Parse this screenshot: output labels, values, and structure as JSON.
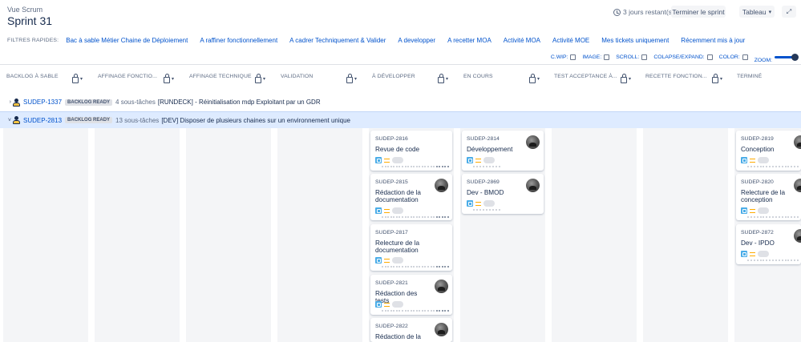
{
  "header": {
    "breadcrumb": "Vue Scrum",
    "title": "Sprint 31",
    "days_remaining": "3 jours restant(s)",
    "end_sprint_label": "Terminer le sprint",
    "board_label": "Tableau",
    "expand_icon": "expand-icon"
  },
  "filters": {
    "label": "FILTRES RAPIDES:",
    "items": [
      "Bac à sable Métier Chaine de Déploiement",
      "A raffiner fonctionnellement",
      "A cadrer Techniquement & Valider",
      "A developper",
      "A recetter MOA",
      "Activité MOA",
      "Activité MOE",
      "Mes tickets uniquement",
      "Récemment mis à jour"
    ]
  },
  "toggles": {
    "cwip": "C.WIP:",
    "image": "IMAGE:",
    "scroll": "SCROLL:",
    "colapse": "COLAPSE/EXPAND:",
    "color": "COLOR:",
    "zoom": "ZOOM:"
  },
  "columns": [
    "BACKLOG À SABLE",
    "AFFINAGE FONCTIO...",
    "AFFINAGE TECHNIQUE",
    "VALIDATION",
    "À DÉVELOPPER",
    "EN COURS",
    "TEST ACCEPTANCE À...",
    "RECETTE FONCTION...",
    "TERMINÉ"
  ],
  "swimlanes": [
    {
      "key": "SUDEP-1337",
      "badge": "BACKLOG READY",
      "subtasks": "4 sous-tâches",
      "summary": "[RUNDECK] - Réinitialisation mdp Exploitant par un GDR"
    },
    {
      "key": "SUDEP-2813",
      "badge": "BACKLOG READY",
      "subtasks": "13 sous-tâches",
      "summary": "[DEV] Disposer de plusieurs chaines sur un environnement unique"
    }
  ],
  "cards": {
    "a_developper": [
      {
        "key": "SUDEP-2816",
        "summary": "Revue de code"
      },
      {
        "key": "SUDEP-2815",
        "summary": "Rédaction de la documentation"
      },
      {
        "key": "SUDEP-2817",
        "summary": "Relecture de la documentation"
      },
      {
        "key": "SUDEP-2821",
        "summary": "Rédaction des tests"
      },
      {
        "key": "SUDEP-2822",
        "summary": "Rédaction de la"
      }
    ],
    "en_cours": [
      {
        "key": "SUDEP-2814",
        "summary": "Développement"
      },
      {
        "key": "SUDEP-2869",
        "summary": "Dev - BMOD"
      }
    ],
    "termine": [
      {
        "key": "SUDEP-2819",
        "summary": "Conception"
      },
      {
        "key": "SUDEP-2820",
        "summary": "Relecture de la conception"
      },
      {
        "key": "SUDEP-2872",
        "summary": "Dev - IPDO"
      }
    ]
  },
  "colors": {
    "link": "#0052cc",
    "swimlane_highlight": "#deebff",
    "column_bg": "#f4f5f7",
    "story_icon": "#4bade8",
    "priority_medium": "#ffab00"
  }
}
